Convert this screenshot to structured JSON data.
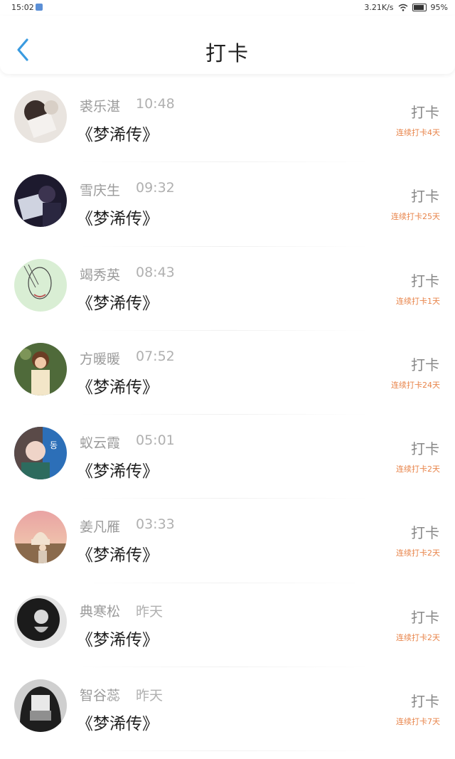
{
  "status_bar": {
    "time": "15:02",
    "network_speed": "3.21K/s",
    "battery": "95%"
  },
  "header": {
    "title": "打卡",
    "back_icon": "chevron-left-icon",
    "accent_color": "#3a9be0"
  },
  "checkin_list": [
    {
      "name": "裘乐湛",
      "time": "10:48",
      "book": "《梦浠传》",
      "action": "打卡",
      "streak": "连续打卡4天"
    },
    {
      "name": "雪庆生",
      "time": "09:32",
      "book": "《梦浠传》",
      "action": "打卡",
      "streak": "连续打卡25天"
    },
    {
      "name": "竭秀英",
      "time": "08:43",
      "book": "《梦浠传》",
      "action": "打卡",
      "streak": "连续打卡1天"
    },
    {
      "name": "方暖暖",
      "time": "07:52",
      "book": "《梦浠传》",
      "action": "打卡",
      "streak": "连续打卡24天"
    },
    {
      "name": "蚁云霞",
      "time": "05:01",
      "book": "《梦浠传》",
      "action": "打卡",
      "streak": "连续打卡2天"
    },
    {
      "name": "姜凡雁",
      "time": "03:33",
      "book": "《梦浠传》",
      "action": "打卡",
      "streak": "连续打卡2天"
    },
    {
      "name": "典寒松",
      "time": "昨天",
      "book": "《梦浠传》",
      "action": "打卡",
      "streak": "连续打卡2天"
    },
    {
      "name": "智谷蕊",
      "time": "昨天",
      "book": "《梦浠传》",
      "action": "打卡",
      "streak": "连续打卡7天"
    }
  ],
  "colors": {
    "streak": "#e8844a",
    "name": "#9b9b9b",
    "title": "#222222"
  }
}
